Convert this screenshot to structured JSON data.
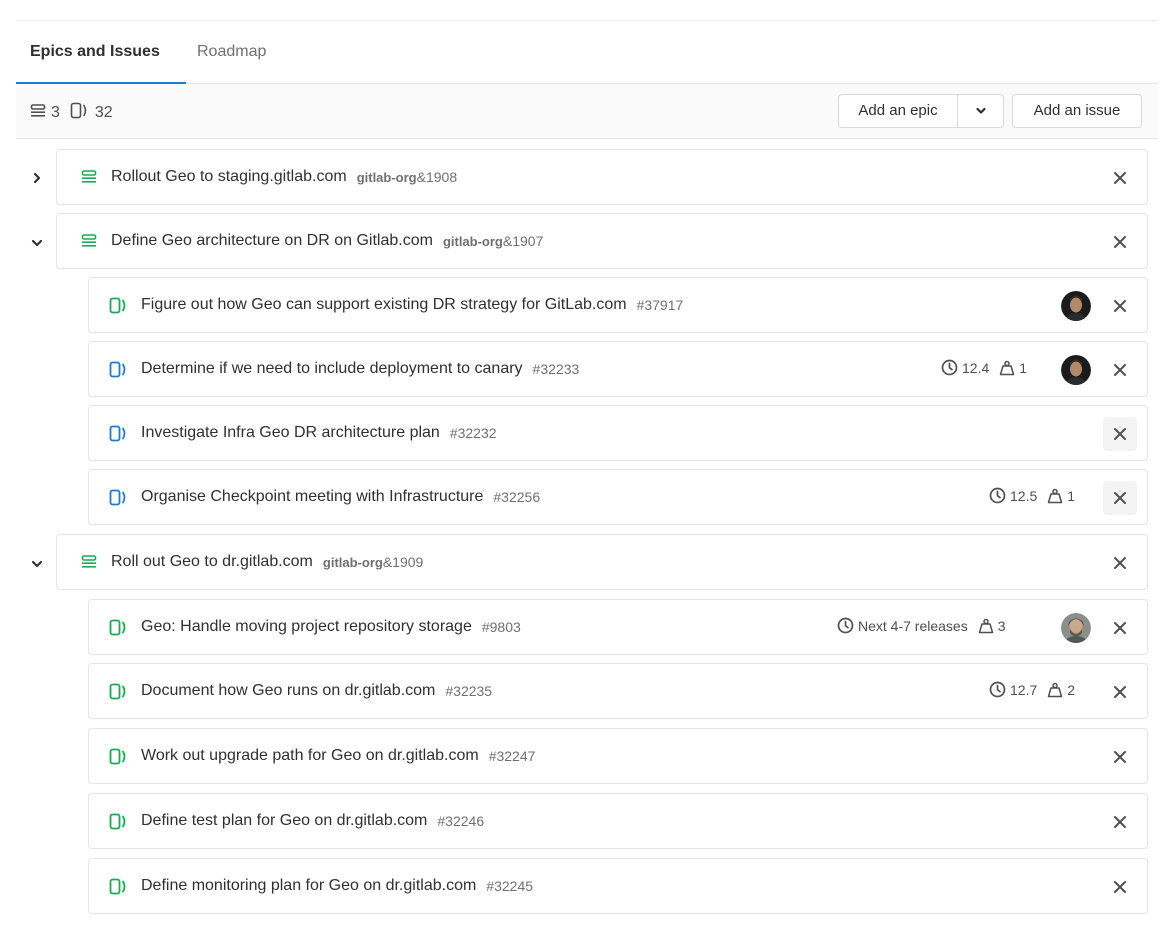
{
  "tabs": [
    {
      "label": "Epics and Issues",
      "active": true
    },
    {
      "label": "Roadmap",
      "active": false
    }
  ],
  "header": {
    "epic_count": "3",
    "issue_count": "32",
    "add_epic_label": "Add an epic",
    "add_issue_label": "Add an issue"
  },
  "colors": {
    "epic_green": "#1aaa55",
    "issue_blue": "#1f78d1",
    "tab_accent": "#1f78d1"
  },
  "rows": [
    {
      "type": "epic",
      "title": "Rollout Geo to staging.gitlab.com",
      "ref_strong": "gitlab-org",
      "ref_tail": "&1908",
      "expanded": false
    },
    {
      "type": "epic",
      "title": "Define Geo architecture on DR on Gitlab.com",
      "ref_strong": "gitlab-org",
      "ref_tail": "&1907",
      "expanded": true
    },
    {
      "type": "issue",
      "state": "closed",
      "title": "Figure out how Geo can support existing DR strategy for GitLab.com",
      "ref": "#37917",
      "avatar": true
    },
    {
      "type": "issue",
      "state": "open",
      "title": "Determine if we need to include deployment to canary",
      "ref": "#32233",
      "milestone": "12.4",
      "weight": "1",
      "avatar": true
    },
    {
      "type": "issue",
      "state": "open",
      "title": "Investigate Infra Geo DR architecture plan",
      "ref": "#32232"
    },
    {
      "type": "issue",
      "state": "open",
      "title": "Organise Checkpoint meeting with Infrastructure",
      "ref": "#32256",
      "milestone": "12.5",
      "weight": "1"
    },
    {
      "type": "epic",
      "title": "Roll out Geo to dr.gitlab.com",
      "ref_strong": "gitlab-org",
      "ref_tail": "&1909",
      "expanded": true
    },
    {
      "type": "issue",
      "state": "closed",
      "title": "Geo: Handle moving project repository storage",
      "ref": "#9803",
      "milestone": "Next 4-7 releases",
      "weight": "3",
      "avatar": true
    },
    {
      "type": "issue",
      "state": "closed",
      "title": "Document how Geo runs on dr.gitlab.com",
      "ref": "#32235",
      "milestone": "12.7",
      "weight": "2"
    },
    {
      "type": "issue",
      "state": "closed",
      "title": "Work out upgrade path for Geo on dr.gitlab.com",
      "ref": "#32247"
    },
    {
      "type": "issue",
      "state": "closed",
      "title": "Define test plan for Geo on dr.gitlab.com",
      "ref": "#32246"
    },
    {
      "type": "issue",
      "state": "closed",
      "title": "Define monitoring plan for Geo on dr.gitlab.com",
      "ref": "#32245"
    }
  ]
}
